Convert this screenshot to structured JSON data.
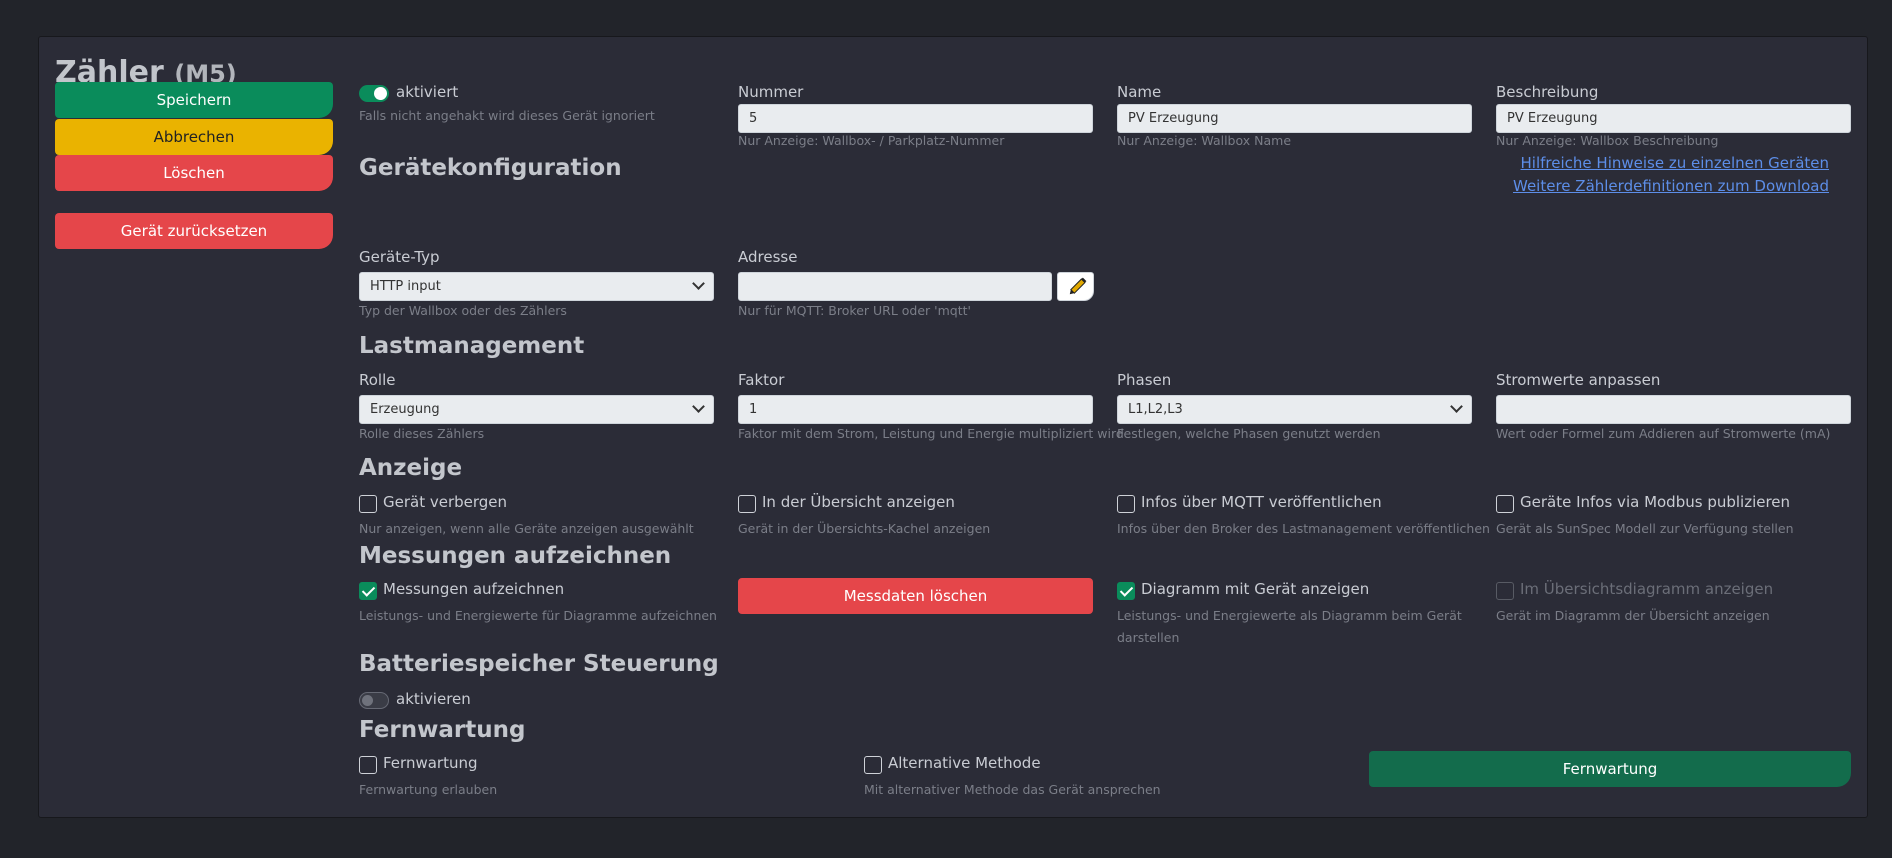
{
  "header": {
    "title": "Zähler",
    "suffix": "(M5)"
  },
  "sidebar": {
    "save": "Speichern",
    "cancel": "Abbrechen",
    "delete": "Löschen",
    "reset": "Gerät zurücksetzen"
  },
  "general": {
    "enabled_label": "aktiviert",
    "enabled_help": "Falls nicht angehakt wird dieses Gerät ignoriert",
    "number_label": "Nummer",
    "number_value": "5",
    "number_help": "Nur Anzeige: Wallbox- / Parkplatz-Nummer",
    "name_label": "Name",
    "name_value": "PV Erzeugung",
    "name_help": "Nur Anzeige: Wallbox Name",
    "desc_label": "Beschreibung",
    "desc_value": "PV Erzeugung",
    "desc_help": "Nur Anzeige: Wallbox Beschreibung"
  },
  "config": {
    "heading": "Gerätekonfiguration",
    "link_hints": "Hilfreiche Hinweise zu einzelnen Geräten",
    "link_defs": "Weitere Zählerdefinitionen zum Download",
    "type_label": "Geräte-Typ",
    "type_value": "HTTP input",
    "type_help": "Typ der Wallbox oder des Zählers",
    "address_label": "Adresse",
    "address_value": "",
    "address_help": "Nur für MQTT: Broker URL oder 'mqtt'"
  },
  "load": {
    "heading": "Lastmanagement",
    "role_label": "Rolle",
    "role_value": "Erzeugung",
    "role_help": "Rolle dieses Zählers",
    "factor_label": "Faktor",
    "factor_value": "1",
    "factor_help": "Faktor mit dem Strom, Leistung und Energie multipliziert wird",
    "phases_label": "Phasen",
    "phases_value": "L1,L2,L3",
    "phases_help": "Festlegen, welche Phasen genutzt werden",
    "adjust_label": "Stromwerte anpassen",
    "adjust_value": "",
    "adjust_help": "Wert oder Formel zum Addieren auf Stromwerte (mA)"
  },
  "display": {
    "heading": "Anzeige",
    "hide_label": "Gerät verbergen",
    "hide_help": "Nur anzeigen, wenn alle Geräte anzeigen ausgewählt",
    "overview_label": "In der Übersicht anzeigen",
    "overview_help": "Gerät in der Übersichts-Kachel anzeigen",
    "mqtt_label": "Infos über MQTT veröffentlichen",
    "mqtt_help": "Infos über den Broker des Lastmanagement veröffentlichen",
    "modbus_label": "Geräte Infos via Modbus publizieren",
    "modbus_help": "Gerät als SunSpec Modell zur Verfügung stellen"
  },
  "record": {
    "heading": "Messungen aufzeichnen",
    "rec_label": "Messungen aufzeichnen",
    "rec_help": "Leistungs- und Energiewerte für Diagramme aufzeichnen",
    "delete_btn": "Messdaten löschen",
    "diag_label": "Diagramm mit Gerät anzeigen",
    "diag_help_1": "Leistungs- und Energiewerte als Diagramm beim Gerät",
    "diag_help_2": "darstellen",
    "overview_diag_label": "Im Übersichtsdiagramm anzeigen",
    "overview_diag_help": "Gerät im Diagramm der Übersicht anzeigen"
  },
  "battery": {
    "heading": "Batteriespeicher Steuerung",
    "activate_label": "aktivieren"
  },
  "remote": {
    "heading": "Fernwartung",
    "remote_label": "Fernwartung",
    "remote_help": "Fernwartung erlauben",
    "alt_label": "Alternative Methode",
    "alt_help": "Mit alternativer Methode das Gerät ansprechen",
    "button": "Fernwartung"
  },
  "colors": {
    "primary": "#0a8c5b",
    "warning": "#eab300",
    "danger": "#e5464a",
    "link": "#5d8ee8"
  }
}
